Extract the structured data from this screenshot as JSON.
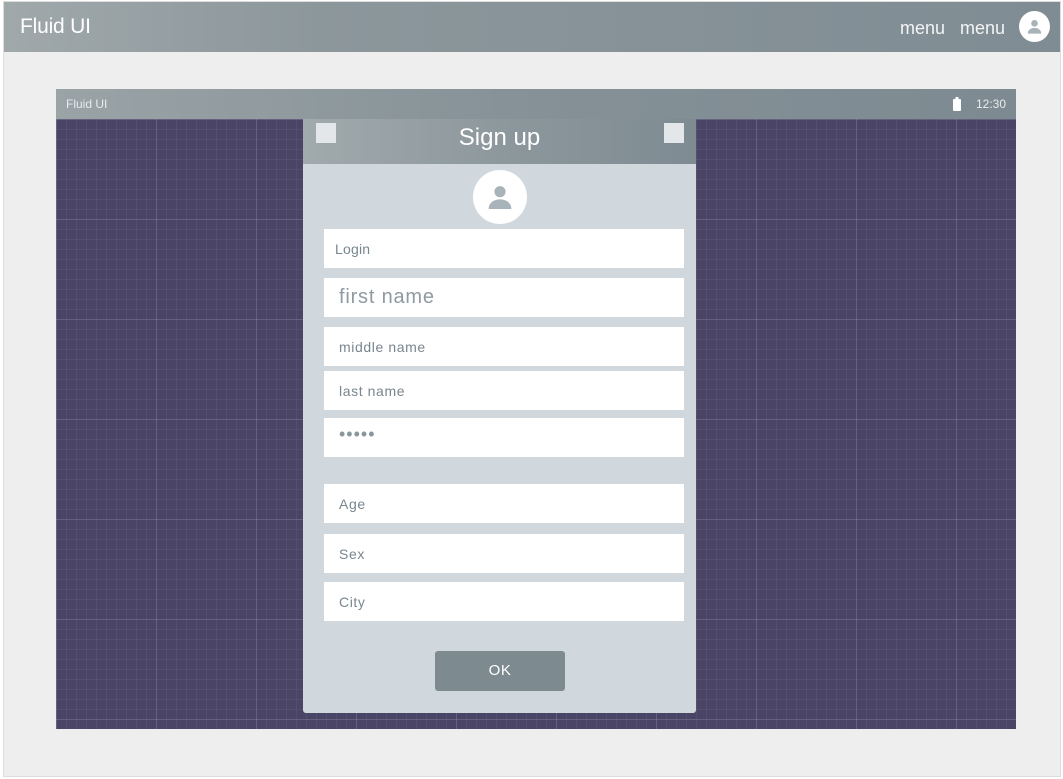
{
  "appbar": {
    "title": "Fluid UI",
    "menu_items": [
      "menu",
      "menu"
    ]
  },
  "device": {
    "status_title": "Fluid UI",
    "time": "12:30"
  },
  "dialog": {
    "title": "Sign up",
    "fields": {
      "login": "Login",
      "first_name": "first name",
      "middle_name": "middle name",
      "last_name": "last name",
      "password": "•••••",
      "age": "Age",
      "sex": "Sex",
      "city": "City"
    },
    "ok_label": "OK"
  },
  "colors": {
    "header_gradient_start": "#a0a8aa",
    "header_gradient_end": "#7f8c93",
    "device_background": "#4a4466",
    "dialog_background": "#d0d8de",
    "ok_button": "#7d8b90"
  },
  "icons": {
    "appbar_avatar": "user-avatar-icon",
    "dialog_avatar": "user-avatar-icon",
    "battery": "battery-icon"
  }
}
